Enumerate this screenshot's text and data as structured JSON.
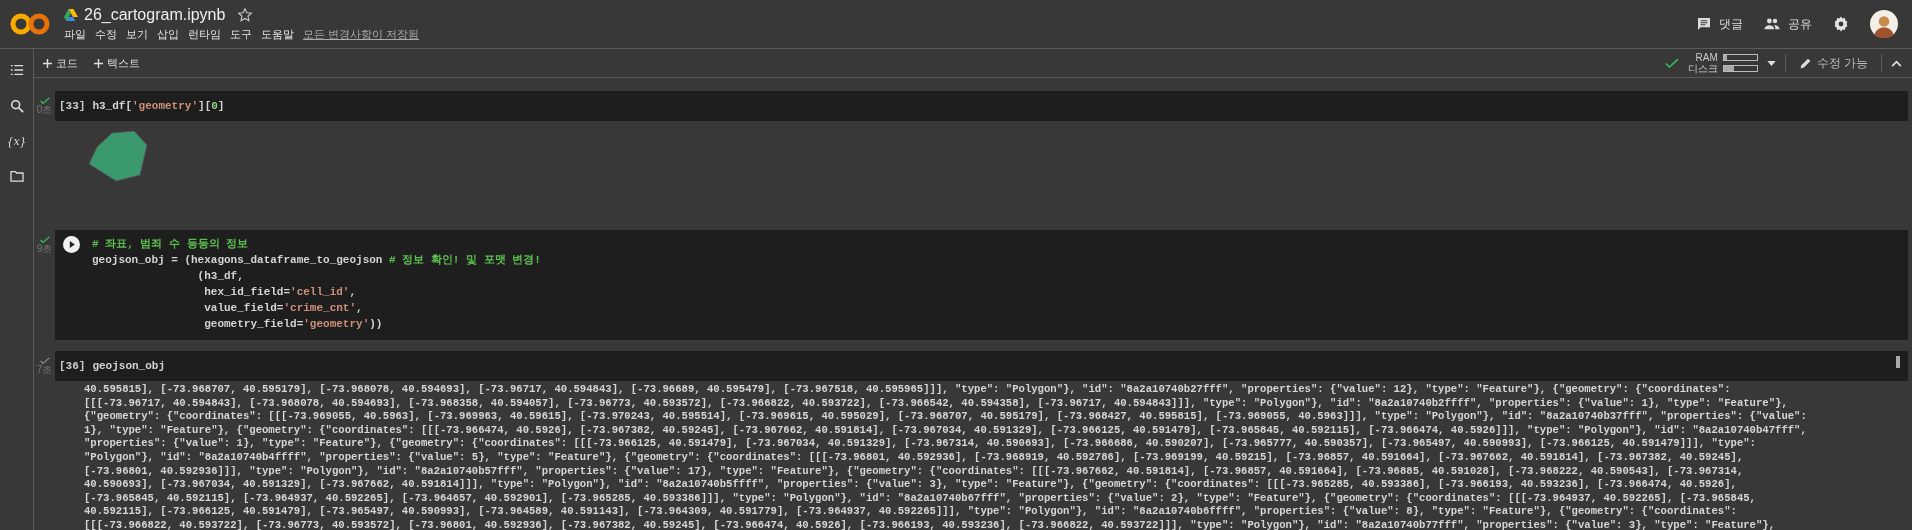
{
  "header": {
    "file_name": "26_cartogram.ipynb",
    "starred": false,
    "menu": [
      "파일",
      "수정",
      "보기",
      "삽입",
      "런타임",
      "도구",
      "도움말"
    ],
    "save_status": "모든 변경사항이 저장됨",
    "actions": [
      {
        "kind": "comment",
        "label": "댓글"
      },
      {
        "kind": "share",
        "label": "공유"
      },
      {
        "kind": "settings"
      },
      {
        "kind": "avatar"
      }
    ]
  },
  "toolbar": {
    "add_buttons": [
      {
        "label": "코드"
      },
      {
        "label": "텍스트"
      }
    ],
    "connected": true,
    "resources": [
      {
        "label": "RAM",
        "level": 0.1
      },
      {
        "label": "디스크",
        "level": 0.32
      }
    ],
    "edit_status": "수정 가능"
  },
  "sidebar": [
    {
      "kind": "toc"
    },
    {
      "kind": "search"
    },
    {
      "kind": "variables",
      "glyph": "{x}"
    },
    {
      "kind": "files"
    }
  ],
  "cells": [
    {
      "execution_count": "[33]",
      "check_faded": false,
      "time": "0초",
      "run_button": false,
      "code": [
        [
          {
            "kind": "plain",
            "text": "h3_df["
          },
          {
            "kind": "string",
            "text": "'geometry'"
          },
          {
            "kind": "plain",
            "text": "]["
          },
          {
            "kind": "number",
            "text": "0"
          },
          {
            "kind": "plain",
            "text": "]"
          }
        ]
      ],
      "output": {
        "kind": "shape"
      }
    },
    {
      "check_faded": false,
      "time": "9초",
      "run_button": true,
      "code": [
        [
          {
            "kind": "comment",
            "text": "# 좌표, 범죄 수 등등의 정보"
          }
        ],
        [
          {
            "kind": "plain",
            "text": "geojson_obj = (hexagons_dataframe_to_geojson "
          },
          {
            "kind": "comment",
            "text": "# 정보 확인! 및 포맷 변경!"
          }
        ],
        [
          {
            "kind": "plain",
            "text": "                (h3_df,"
          }
        ],
        [
          {
            "kind": "plain",
            "text": "                 hex_id_field="
          },
          {
            "kind": "string",
            "text": "'cell_id'"
          },
          {
            "kind": "plain",
            "text": ","
          }
        ],
        [
          {
            "kind": "plain",
            "text": "                 value_field="
          },
          {
            "kind": "string",
            "text": "'crime_cnt'"
          },
          {
            "kind": "plain",
            "text": ","
          }
        ],
        [
          {
            "kind": "plain",
            "text": "                 geometry_field="
          },
          {
            "kind": "string",
            "text": "'geometry'"
          },
          {
            "kind": "plain",
            "text": "))"
          }
        ]
      ]
    },
    {
      "execution_count": "[36]",
      "check_faded": true,
      "time": "7초",
      "run_button": false,
      "code": [
        [
          {
            "kind": "plain",
            "text": "geojson_obj"
          }
        ]
      ],
      "output": {
        "kind": "text",
        "lines": [
          "40.595815], [-73.968707, 40.595179], [-73.968078, 40.594693], [-73.96717, 40.594843], [-73.96689, 40.595479], [-73.967518, 40.595965]]], \"type\": \"Polygon\"}, \"id\": \"8a2a10740b27fff\", \"properties\": {\"value\": 12}, \"type\": \"Feature\"}, {\"geometry\": {\"coordinates\":",
          "[[[-73.96717, 40.594843], [-73.968078, 40.594693], [-73.968358, 40.594057], [-73.96773, 40.593572], [-73.966822, 40.593722], [-73.966542, 40.594358], [-73.96717, 40.594843]]], \"type\": \"Polygon\"}, \"id\": \"8a2a10740b2ffff\", \"properties\": {\"value\": 1}, \"type\": \"Feature\"},",
          "{\"geometry\": {\"coordinates\": [[[-73.969055, 40.5963], [-73.969963, 40.59615], [-73.970243, 40.595514], [-73.969615, 40.595029], [-73.968707, 40.595179], [-73.968427, 40.595815], [-73.969055, 40.5963]]], \"type\": \"Polygon\"}, \"id\": \"8a2a10740b37fff\", \"properties\": {\"value\":",
          "1}, \"type\": \"Feature\"}, {\"geometry\": {\"coordinates\": [[[-73.966474, 40.5926], [-73.967382, 40.59245], [-73.967662, 40.591814], [-73.967034, 40.591329], [-73.966125, 40.591479], [-73.965845, 40.592115], [-73.966474, 40.5926]]], \"type\": \"Polygon\"}, \"id\": \"8a2a10740b47fff\",",
          "\"properties\": {\"value\": 1}, \"type\": \"Feature\"}, {\"geometry\": {\"coordinates\": [[[-73.966125, 40.591479], [-73.967034, 40.591329], [-73.967314, 40.590693], [-73.966686, 40.590207], [-73.965777, 40.590357], [-73.965497, 40.590993], [-73.966125, 40.591479]]], \"type\":",
          "\"Polygon\"}, \"id\": \"8a2a10740b4ffff\", \"properties\": {\"value\": 5}, \"type\": \"Feature\"}, {\"geometry\": {\"coordinates\": [[[-73.96801, 40.592936], [-73.968919, 40.592786], [-73.969199, 40.59215], [-73.96857, 40.591664], [-73.967662, 40.591814], [-73.967382, 40.59245],",
          "[-73.96801, 40.592936]]], \"type\": \"Polygon\"}, \"id\": \"8a2a10740b57fff\", \"properties\": {\"value\": 17}, \"type\": \"Feature\"}, {\"geometry\": {\"coordinates\": [[[-73.967662, 40.591814], [-73.96857, 40.591664], [-73.96885, 40.591028], [-73.968222, 40.590543], [-73.967314,",
          "40.590693], [-73.967034, 40.591329], [-73.967662, 40.591814]]], \"type\": \"Polygon\"}, \"id\": \"8a2a10740b5ffff\", \"properties\": {\"value\": 3}, \"type\": \"Feature\"}, {\"geometry\": {\"coordinates\": [[[-73.965285, 40.593386], [-73.966193, 40.593236], [-73.966474, 40.5926],",
          "[-73.965845, 40.592115], [-73.964937, 40.592265], [-73.964657, 40.592901], [-73.965285, 40.593386]]], \"type\": \"Polygon\"}, \"id\": \"8a2a10740b67fff\", \"properties\": {\"value\": 2}, \"type\": \"Feature\"}, {\"geometry\": {\"coordinates\": [[[-73.964937, 40.592265], [-73.965845,",
          "40.592115], [-73.966125, 40.591479], [-73.965497, 40.590993], [-73.964589, 40.591143], [-73.964309, 40.591779], [-73.964937, 40.592265]]], \"type\": \"Polygon\"}, \"id\": \"8a2a10740b6ffff\", \"properties\": {\"value\": 8}, \"type\": \"Feature\"}, {\"geometry\": {\"coordinates\":",
          "[[[-73.966822, 40.593722], [-73.96773, 40.593572], [-73.96801, 40.592936], [-73.967382, 40.59245], [-73.966474, 40.5926], [-73.966193, 40.593236], [-73.966822, 40.593722]]], \"type\": \"Polygon\"}, \"id\": \"8a2a10740b77fff\", \"properties\": {\"value\": 3}, \"type\": \"Feature\"},"
        ]
      }
    }
  ]
}
